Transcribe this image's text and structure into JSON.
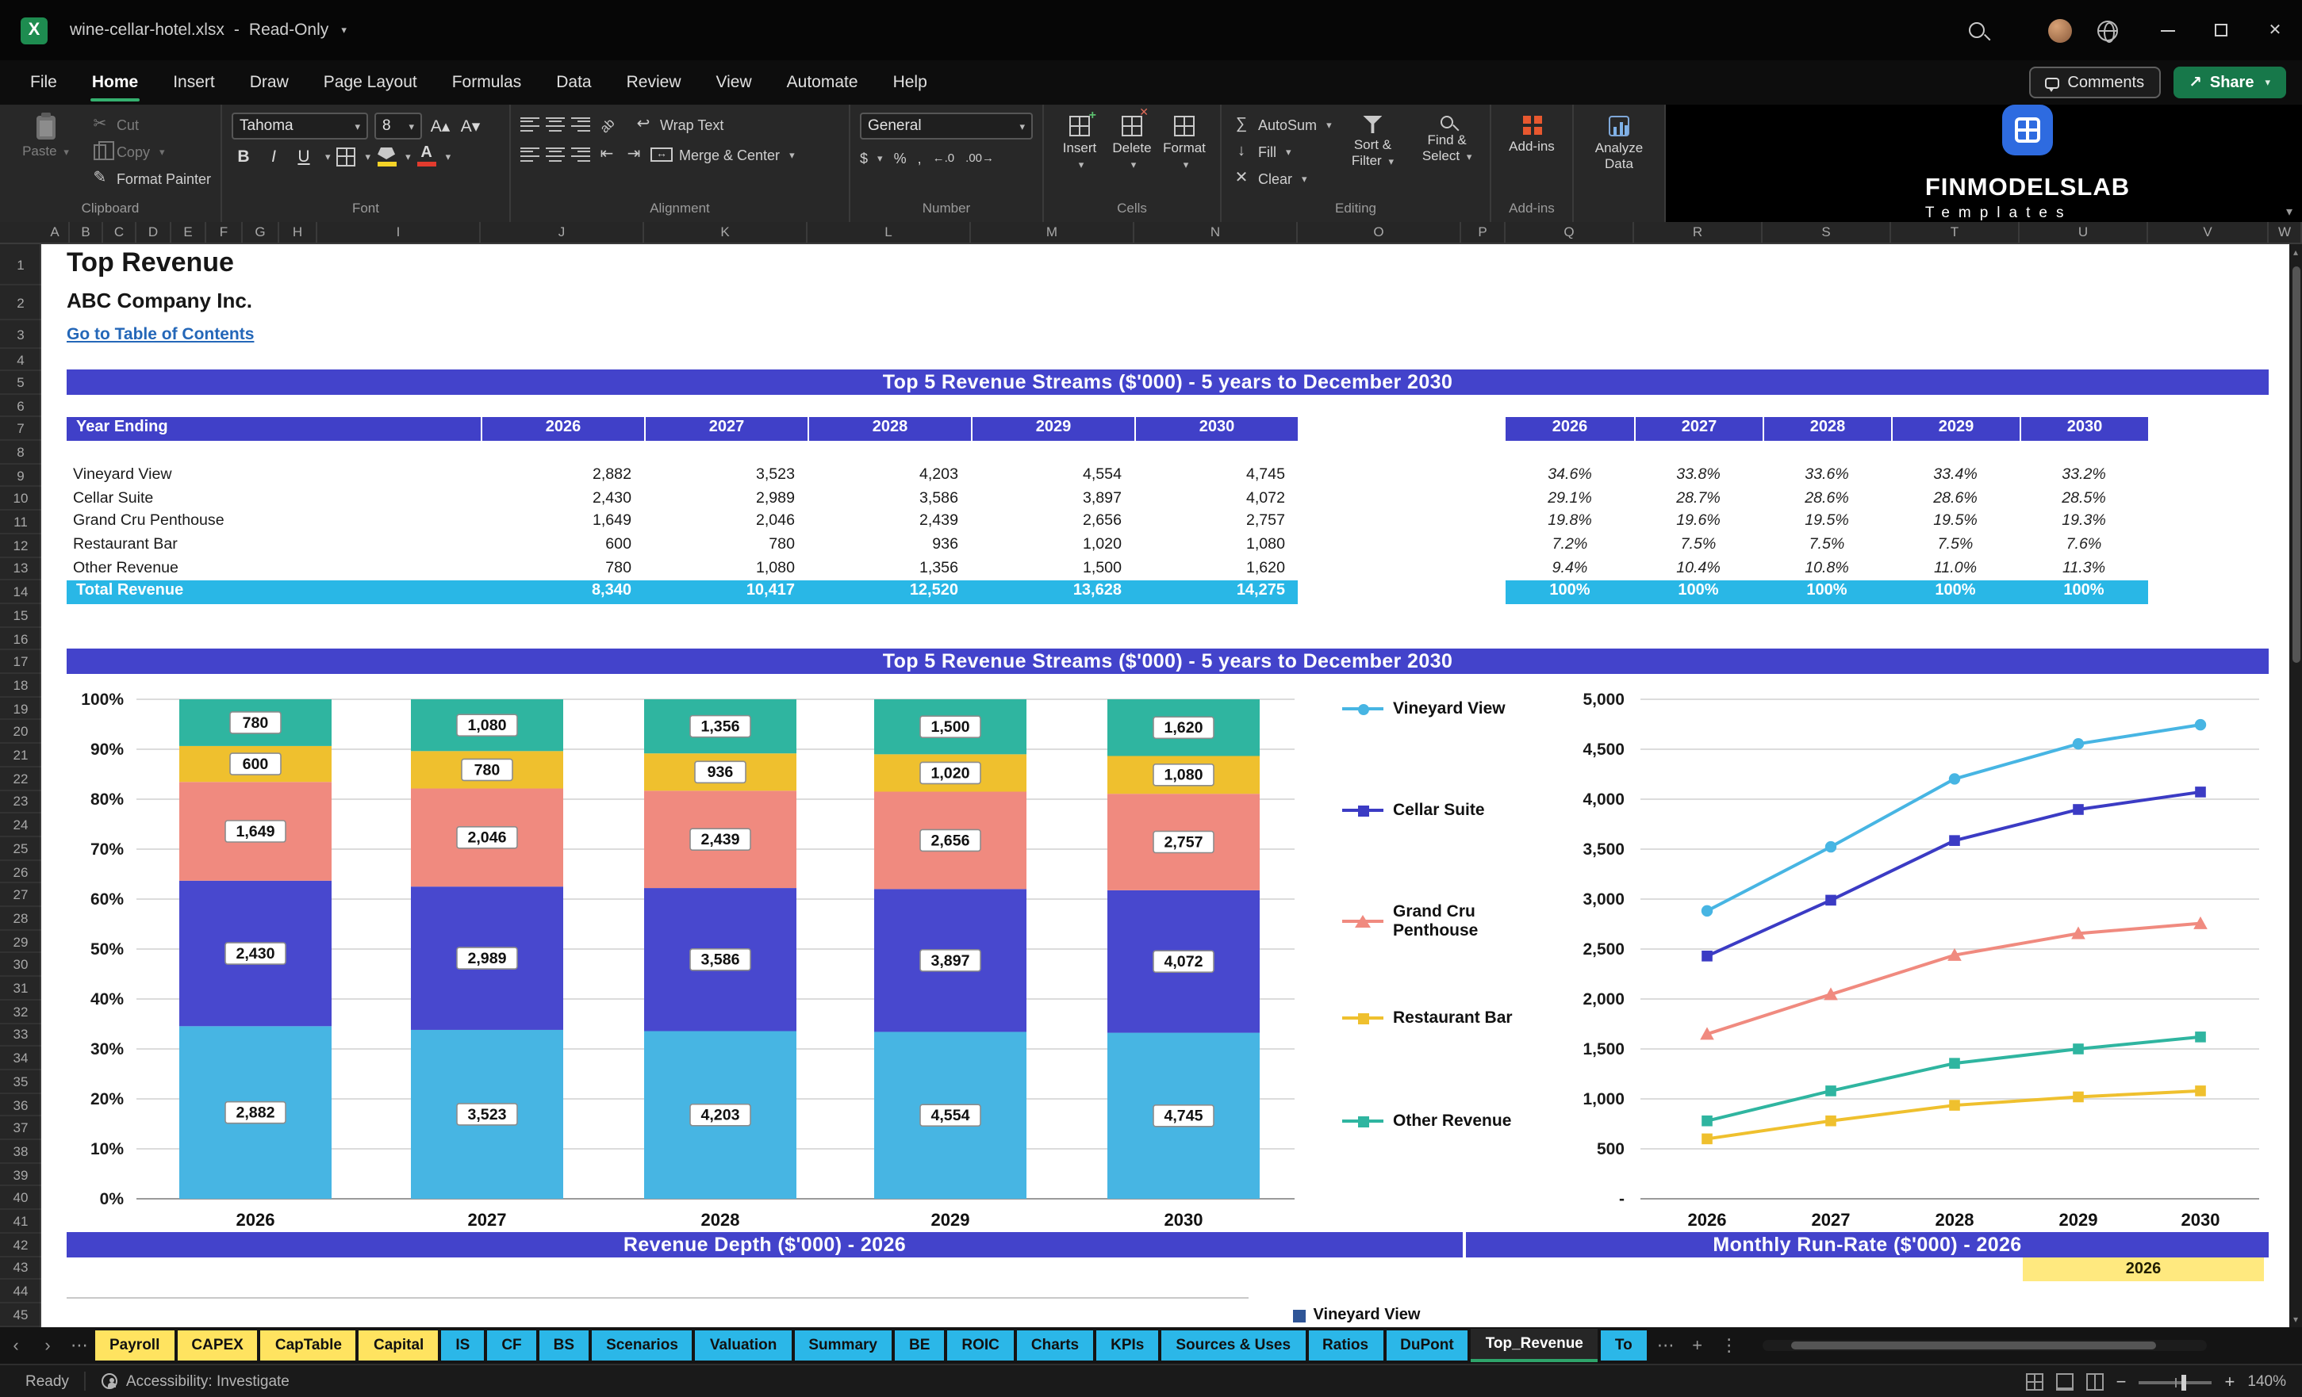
{
  "window": {
    "title": "wine-cellar-hotel.xlsx",
    "dash": "-",
    "mode": "Read-Only"
  },
  "menu": {
    "tabs": [
      "File",
      "Home",
      "Insert",
      "Draw",
      "Page Layout",
      "Formulas",
      "Data",
      "Review",
      "View",
      "Automate",
      "Help"
    ],
    "active_tab": "Home",
    "comments": "Comments",
    "share": "Share"
  },
  "ribbon": {
    "clipboard": {
      "label": "Clipboard",
      "paste": "Paste",
      "cut": "Cut",
      "copy": "Copy",
      "format_painter": "Format Painter"
    },
    "font": {
      "label": "Font",
      "name": "Tahoma",
      "size": "8",
      "bold": "B",
      "italic": "I",
      "underline": "U"
    },
    "alignment": {
      "label": "Alignment",
      "wrap": "Wrap Text",
      "merge": "Merge & Center"
    },
    "number": {
      "label": "Number",
      "format": "General",
      "dollar": "$",
      "percent": "%",
      "comma": ","
    },
    "cells": {
      "label": "Cells",
      "insert": "Insert",
      "delete": "Delete",
      "format": "Format"
    },
    "editing": {
      "label": "Editing",
      "autosum": "AutoSum",
      "fill": "Fill",
      "clear": "Clear",
      "sort": "Sort & Filter",
      "find": "Find & Select"
    },
    "addins": {
      "label": "Add-ins"
    },
    "analyze": {
      "label": "Analyze Data"
    },
    "brand": {
      "name": "FINMODELSLAB",
      "sub": "Templates"
    }
  },
  "grid": {
    "col_letters": [
      "A",
      "B",
      "C",
      "D",
      "E",
      "F",
      "G",
      "H",
      "I",
      "J",
      "K",
      "L",
      "M",
      "N",
      "O",
      "P",
      "Q",
      "R",
      "S",
      "T",
      "U",
      "V",
      "W"
    ],
    "row_count": 45
  },
  "content": {
    "title": "Top Revenue",
    "company": "ABC Company Inc.",
    "toc_link": "Go to Table of Contents",
    "banner_top": "Top 5 Revenue Streams ($'000) - 5 years to December 2030",
    "banner_chart": "Top 5 Revenue Streams ($'000) - 5 years to December 2030",
    "banner_depth": "Revenue Depth ($'000) - 2026",
    "banner_runrate": "Monthly Run-Rate ($'000) - 2026",
    "runrate_year": "2026",
    "bottom_legend": "Vineyard View",
    "bottom_legend_color": "#2F5597",
    "colors": {
      "header": "#4040C8",
      "banner": "#4343CB",
      "total": "#29B7E6",
      "year_cell": "#FFE97F",
      "link": "#2467B8"
    },
    "table": {
      "header_label": "Year Ending",
      "years": [
        "2026",
        "2027",
        "2028",
        "2029",
        "2030"
      ],
      "rows": [
        {
          "label": "Vineyard View",
          "values": [
            "2,882",
            "3,523",
            "4,203",
            "4,554",
            "4,745"
          ],
          "pct": [
            "34.6%",
            "33.8%",
            "33.6%",
            "33.4%",
            "33.2%"
          ]
        },
        {
          "label": "Cellar Suite",
          "values": [
            "2,430",
            "2,989",
            "3,586",
            "3,897",
            "4,072"
          ],
          "pct": [
            "29.1%",
            "28.7%",
            "28.6%",
            "28.6%",
            "28.5%"
          ]
        },
        {
          "label": "Grand Cru Penthouse",
          "values": [
            "1,649",
            "2,046",
            "2,439",
            "2,656",
            "2,757"
          ],
          "pct": [
            "19.8%",
            "19.6%",
            "19.5%",
            "19.5%",
            "19.3%"
          ]
        },
        {
          "label": "Restaurant Bar",
          "values": [
            "600",
            "780",
            "936",
            "1,020",
            "1,080"
          ],
          "pct": [
            "7.2%",
            "7.5%",
            "7.5%",
            "7.5%",
            "7.6%"
          ]
        },
        {
          "label": "Other Revenue",
          "values": [
            "780",
            "1,080",
            "1,356",
            "1,500",
            "1,620"
          ],
          "pct": [
            "9.4%",
            "10.4%",
            "10.8%",
            "11.0%",
            "11.3%"
          ]
        }
      ],
      "total": {
        "label": "Total Revenue",
        "values": [
          "8,340",
          "10,417",
          "12,520",
          "13,628",
          "14,275"
        ],
        "pct": [
          "100%",
          "100%",
          "100%",
          "100%",
          "100%"
        ]
      }
    }
  },
  "chart_data": [
    {
      "type": "bar",
      "variant": "stacked-100",
      "title": "Top 5 Revenue Streams ($'000) - 5 years to December 2030",
      "categories": [
        "2026",
        "2027",
        "2028",
        "2029",
        "2030"
      ],
      "series": [
        {
          "name": "Vineyard View",
          "color": "#47B5E3",
          "values": [
            2882,
            3523,
            4203,
            4554,
            4745
          ]
        },
        {
          "name": "Cellar Suite",
          "color": "#4848CE",
          "values": [
            2430,
            2989,
            3586,
            3897,
            4072
          ]
        },
        {
          "name": "Grand Cru Penthouse",
          "color": "#F08A7F",
          "values": [
            1649,
            2046,
            2439,
            2656,
            2757
          ]
        },
        {
          "name": "Restaurant Bar",
          "color": "#EFC02E",
          "values": [
            600,
            780,
            936,
            1020,
            1080
          ]
        },
        {
          "name": "Other Revenue",
          "color": "#2FB5A0",
          "values": [
            780,
            1080,
            1356,
            1500,
            1620
          ]
        }
      ],
      "y_axis": {
        "min": 0,
        "max": 1,
        "format": "percent",
        "ticks": [
          "0%",
          "10%",
          "20%",
          "30%",
          "40%",
          "50%",
          "60%",
          "70%",
          "80%",
          "90%",
          "100%"
        ]
      },
      "data_labels": true,
      "grid": true
    },
    {
      "type": "line",
      "title": "Top 5 Revenue Streams ($'000) - 5 years to December 2030",
      "categories": [
        "2026",
        "2027",
        "2028",
        "2029",
        "2030"
      ],
      "series": [
        {
          "name": "Vineyard View",
          "color": "#47B5E3",
          "marker": "circle",
          "values": [
            2882,
            3523,
            4203,
            4554,
            4745
          ]
        },
        {
          "name": "Cellar Suite",
          "color": "#3B3BC4",
          "marker": "square",
          "values": [
            2430,
            2989,
            3586,
            3897,
            4072
          ]
        },
        {
          "name": "Grand Cru Penthouse",
          "color": "#F08A7F",
          "marker": "triangle",
          "values": [
            1649,
            2046,
            2439,
            2656,
            2757
          ]
        },
        {
          "name": "Restaurant Bar",
          "color": "#EFC02E",
          "marker": "square",
          "values": [
            600,
            780,
            936,
            1020,
            1080
          ]
        },
        {
          "name": "Other Revenue",
          "color": "#2FB5A0",
          "marker": "square",
          "values": [
            780,
            1080,
            1356,
            1500,
            1620
          ]
        }
      ],
      "y_axis": {
        "min": 0,
        "max": 5000,
        "step": 500,
        "zero_label": "-"
      },
      "legend_position": "left",
      "grid": true
    }
  ],
  "sheet_tabs": {
    "items": [
      {
        "label": "Payroll",
        "color": "#FFE360"
      },
      {
        "label": "CAPEX",
        "color": "#FFE360"
      },
      {
        "label": "CapTable",
        "color": "#FFE360"
      },
      {
        "label": "Capital",
        "color": "#FFE360"
      },
      {
        "label": "IS",
        "color": "#2BB7E8"
      },
      {
        "label": "CF",
        "color": "#2BB7E8"
      },
      {
        "label": "BS",
        "color": "#2BB7E8"
      },
      {
        "label": "Scenarios",
        "color": "#2BB7E8"
      },
      {
        "label": "Valuation",
        "color": "#2BB7E8"
      },
      {
        "label": "Summary",
        "color": "#2BB7E8"
      },
      {
        "label": "BE",
        "color": "#2BB7E8"
      },
      {
        "label": "ROIC",
        "color": "#2BB7E8"
      },
      {
        "label": "Charts",
        "color": "#2BB7E8"
      },
      {
        "label": "KPIs",
        "color": "#2BB7E8"
      },
      {
        "label": "Sources & Uses",
        "color": "#2BB7E8"
      },
      {
        "label": "Ratios",
        "color": "#2BB7E8"
      },
      {
        "label": "DuPont",
        "color": "#2BB7E8"
      },
      {
        "label": "Top_Revenue",
        "active": true
      },
      {
        "label": "To",
        "color": "#2BB7E8"
      }
    ]
  },
  "status": {
    "ready": "Ready",
    "accessibility": "Accessibility: Investigate",
    "zoom": "140%"
  }
}
